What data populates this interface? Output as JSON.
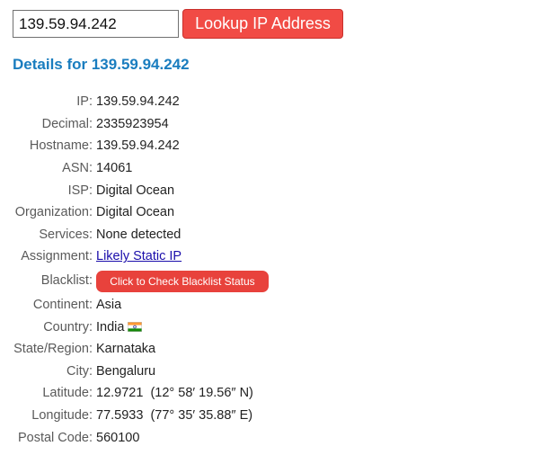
{
  "search": {
    "value": "139.59.94.242",
    "button_label": "Lookup IP Address"
  },
  "details": {
    "title": "Details for 139.59.94.242",
    "rows": [
      {
        "label": "IP:",
        "value": "139.59.94.242"
      },
      {
        "label": "Decimal:",
        "value": "2335923954"
      },
      {
        "label": "Hostname:",
        "value": "139.59.94.242"
      },
      {
        "label": "ASN:",
        "value": "14061"
      },
      {
        "label": "ISP:",
        "value": "Digital Ocean"
      },
      {
        "label": "Organization:",
        "value": "Digital Ocean"
      },
      {
        "label": "Services:",
        "value": "None detected"
      },
      {
        "label": "Assignment:",
        "value": "Likely Static IP"
      },
      {
        "label": "Blacklist:",
        "value": "Click to Check Blacklist Status"
      },
      {
        "label": "Continent:",
        "value": "Asia"
      },
      {
        "label": "Country:",
        "value": "India",
        "icon": "india-flag-icon"
      },
      {
        "label": "State/Region:",
        "value": "Karnataka"
      },
      {
        "label": "City:",
        "value": "Bengaluru"
      },
      {
        "label": "Latitude:",
        "value": "12.9721  (12° 58′ 19.56″ N)"
      },
      {
        "label": "Longitude:",
        "value": "77.5933  (77° 35′ 35.88″ E)"
      },
      {
        "label": "Postal Code:",
        "value": "560100"
      }
    ]
  },
  "colors": {
    "accent_red": "#f14b45",
    "title_blue": "#1a7dbf",
    "link_blue": "#1a0dab"
  }
}
